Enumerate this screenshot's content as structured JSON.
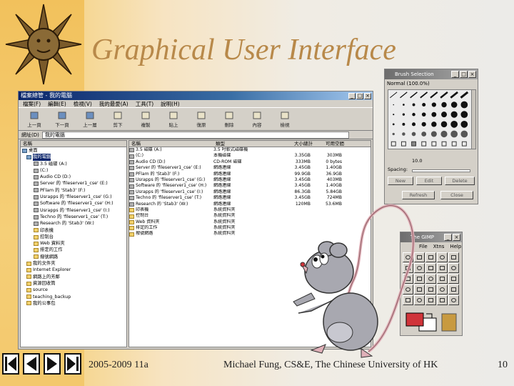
{
  "slide": {
    "title": "Graphical User Interface",
    "footer_left": "2005-2009 11a",
    "footer_center": "Michael Fung, CS&E, The Chinese University of HK",
    "page_number": "10"
  },
  "explorer": {
    "title": "檔案總管 - 我的電腦",
    "menus": [
      "檔案(F)",
      "編輯(E)",
      "檢視(V)",
      "我的最愛(A)",
      "工具(T)",
      "說明(H)"
    ],
    "toolbar": [
      "上一頁",
      "下一頁",
      "上一層",
      "剪下",
      "複製",
      "貼上",
      "復原",
      "刪除",
      "內容",
      "檢視"
    ],
    "address_label": "網址(D)",
    "address_value": "我的電腦",
    "tree_header": "名稱",
    "tree": [
      {
        "label": "桌面",
        "icon": "desktop",
        "sel": false
      },
      {
        "label": "我的電腦",
        "icon": "pc",
        "sel": true
      },
      {
        "label": "3.5 磁碟 (A:)",
        "icon": "drive",
        "sel": false
      },
      {
        "label": "(C:)",
        "icon": "drive",
        "sel": false
      },
      {
        "label": "Audio CD (D:)",
        "icon": "drive",
        "sel": false
      },
      {
        "label": "Server 的 'fileserver1_cse' (E:)",
        "icon": "drive",
        "sel": false
      },
      {
        "label": "PFlam 的 'Stab3' (F:)",
        "icon": "drive",
        "sel": false
      },
      {
        "label": "Usrapps 的 'fileserver1_cse' (G:)",
        "icon": "drive",
        "sel": false
      },
      {
        "label": "Software 的 'fileserver1_cse' (H:)",
        "icon": "drive",
        "sel": false
      },
      {
        "label": "Usrapps 的 'fileserver1_cse' (I:)",
        "icon": "drive",
        "sel": false
      },
      {
        "label": "Techno 的 'fileserver1_cse' (T:)",
        "icon": "drive",
        "sel": false
      },
      {
        "label": "Research 的 'Stab3' (W:)",
        "icon": "drive",
        "sel": false
      },
      {
        "label": "印表機",
        "icon": "folder",
        "sel": false
      },
      {
        "label": "控制台",
        "icon": "folder",
        "sel": false
      },
      {
        "label": "Web 資料夾",
        "icon": "folder",
        "sel": false
      },
      {
        "label": "排定的工作",
        "icon": "folder",
        "sel": false
      },
      {
        "label": "撥號網路",
        "icon": "folder",
        "sel": false
      },
      {
        "label": "我的文件夾",
        "icon": "folder",
        "sel": false
      },
      {
        "label": "Internet Explorer",
        "icon": "folder",
        "sel": false
      },
      {
        "label": "網路上的芳鄰",
        "icon": "folder",
        "sel": false
      },
      {
        "label": "資源回收筒",
        "icon": "folder",
        "sel": false
      },
      {
        "label": "source",
        "icon": "folder",
        "sel": false
      },
      {
        "label": "teaching_backup",
        "icon": "folder",
        "sel": false
      },
      {
        "label": "我的公事包",
        "icon": "folder",
        "sel": false
      }
    ],
    "list_headers": [
      "名稱",
      "類型",
      "大小總計",
      "可用空間"
    ],
    "list": [
      [
        "3.5 磁碟 (A:)",
        "3.5 吋軟式磁碟機",
        "",
        ""
      ],
      [
        "(C:)",
        "本機磁碟",
        "3.35GB",
        "303MB"
      ],
      [
        "Audio CD (D:)",
        "CD-ROM 磁碟",
        "333MB",
        "0 bytes"
      ],
      [
        "Server 的 'fileserver1_cse' (E:)",
        "網路連線",
        "3.45GB",
        "1.40GB"
      ],
      [
        "PFlam 的 'Stab3' (F:)",
        "網路連線",
        "99.9GB",
        "36.9GB"
      ],
      [
        "Usrapps 的 'fileserver1_cse' (G:)",
        "網路連線",
        "3.45GB",
        "403MB"
      ],
      [
        "Software 的 'fileserver1_cse' (H:)",
        "網路連線",
        "3.45GB",
        "1.40GB"
      ],
      [
        "Usrapps 的 'fileserver1_cse' (I:)",
        "網路連線",
        "86.3GB",
        "5.84GB"
      ],
      [
        "Techno 的 'fileserver1_cse' (T:)",
        "網路連線",
        "3.45GB",
        "724MB"
      ],
      [
        "Research 的 'Stab3' (W:)",
        "網路連線",
        "120MB",
        "53.6MB"
      ],
      [
        "印表機",
        "系統資料夾",
        "",
        ""
      ],
      [
        "控制台",
        "系統資料夾",
        "",
        ""
      ],
      [
        "Web 資料夾",
        "系統資料夾",
        "",
        ""
      ],
      [
        "排定的工作",
        "系統資料夾",
        "",
        ""
      ],
      [
        "撥號網路",
        "系統資料夾",
        "",
        ""
      ]
    ]
  },
  "brush": {
    "title": "Brush Selection",
    "mode": "Normal (100.0%)",
    "spacing_label": "Spacing:",
    "spacing_value": "10.0",
    "buttons": [
      "New",
      "Edit",
      "Delete",
      "Refresh",
      "Close"
    ]
  },
  "toolbox": {
    "title": "The GIMP",
    "menus": [
      "File",
      "Xtns",
      "Help"
    ],
    "fg_color": "#d0343a",
    "bg_color": "#ffffff"
  }
}
